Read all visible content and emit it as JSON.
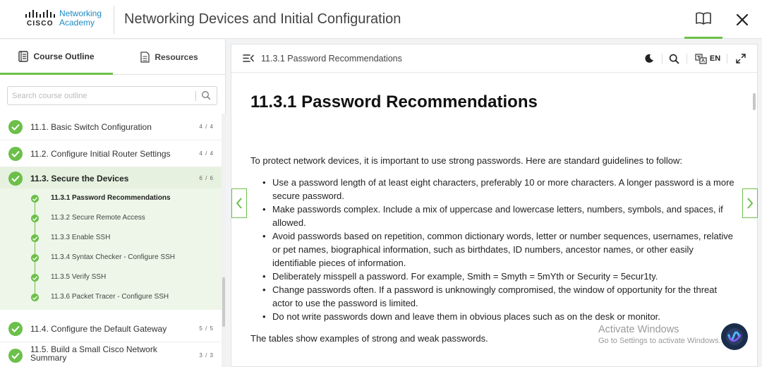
{
  "header": {
    "logo_wordmark": "CISCO",
    "logo_line1": "Networking",
    "logo_line2": "Academy",
    "title": "Networking Devices and Initial Configuration"
  },
  "sidebar": {
    "tabs": [
      {
        "label": "Course Outline",
        "active": true,
        "icon": "outline-icon"
      },
      {
        "label": "Resources",
        "active": false,
        "icon": "document-icon"
      }
    ],
    "search_placeholder": "Search course outline",
    "items": [
      {
        "label": "11.1. Basic Switch Configuration",
        "count": "4 / 4",
        "complete": true
      },
      {
        "label": "11.2. Configure Initial Router Settings",
        "count": "4 / 4",
        "complete": true
      },
      {
        "label": "11.3. Secure the Devices",
        "count": "6 / 6",
        "complete": true,
        "active": true
      },
      {
        "label": "11.4. Configure the Default Gateway",
        "count": "5 / 5",
        "complete": true
      },
      {
        "label": "11.5. Build a Small Cisco Network",
        "label_line2": "Summary",
        "count": "3 / 3",
        "complete": true
      }
    ],
    "subitems": [
      {
        "label": "11.3.1 Password Recommendations",
        "current": true
      },
      {
        "label": "11.3.2 Secure Remote Access"
      },
      {
        "label": "11.3.3 Enable SSH"
      },
      {
        "label": "11.3.4 Syntax Checker - Configure SSH"
      },
      {
        "label": "11.3.5 Verify SSH"
      },
      {
        "label": "11.3.6 Packet Tracer - Configure SSH"
      }
    ]
  },
  "content": {
    "breadcrumb": "11.3.1 Password Recommendations",
    "language": "EN",
    "heading": "11.3.1 Password Recommendations",
    "intro": "To protect network devices, it is important to use strong passwords. Here are standard guidelines to follow:",
    "bullets": [
      "Use a password length of at least eight characters, preferably 10 or more characters. A longer password is a more secure password.",
      "Make passwords complex. Include a mix of uppercase and lowercase letters, numbers, symbols, and spaces, if allowed.",
      "Avoid passwords based on repetition, common dictionary words, letter or number sequences, usernames, relative or pet names, biographical information, such as birthdates, ID numbers, ancestor names, or other easily identifiable pieces of information.",
      "Deliberately misspell a password. For example, Smith = Smyth = 5mYth or Security = 5ecur1ty.",
      "Change passwords often. If a password is unknowingly compromised, the window of opportunity for the threat actor to use the password is limited.",
      "Do not write passwords down and leave them in obvious places such as on the desk or monitor."
    ],
    "outro": "The tables show examples of strong and weak passwords."
  },
  "watermark": {
    "line1": "Activate Windows",
    "line2": "Go to Settings to activate Windows."
  },
  "colors": {
    "accent_green": "#6cc04a",
    "brand_blue": "#1e8bc3"
  }
}
